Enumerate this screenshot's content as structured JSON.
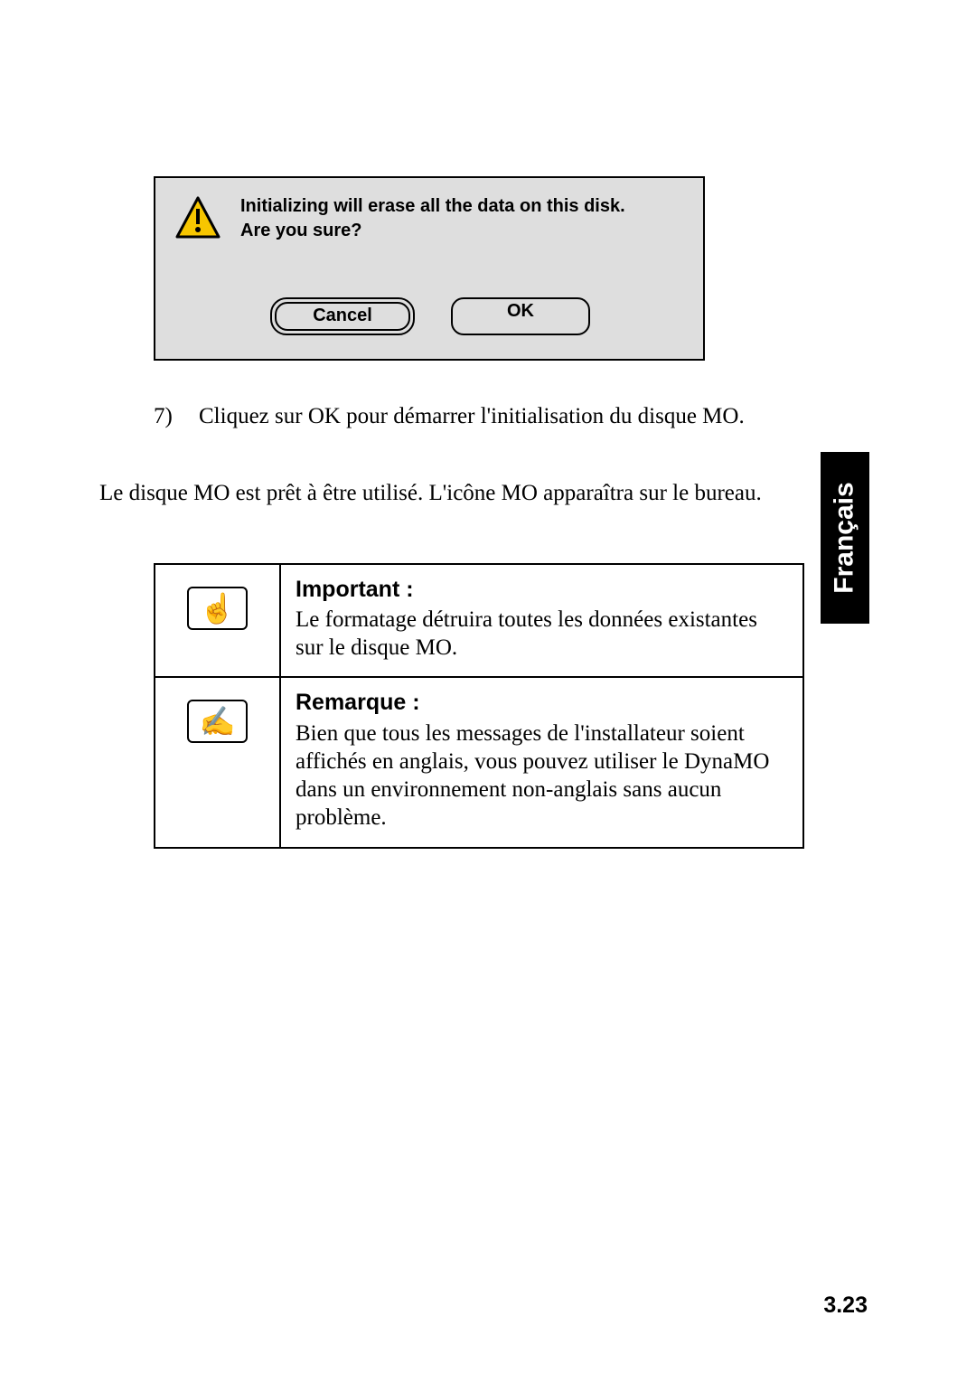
{
  "dialog": {
    "line1": "Initializing will erase all the data on this disk.",
    "line2": "Are you sure?",
    "cancel_label": "Cancel",
    "ok_label": "OK"
  },
  "step": {
    "number": "7)",
    "text": "Cliquez sur OK pour démarrer l'initialisation du disque MO."
  },
  "body_text": "Le disque MO est prêt à être utilisé. L'icône MO apparaîtra sur le bureau.",
  "callouts": {
    "important": {
      "title": "Important :",
      "text": "Le formatage détruira toutes les données existantes sur le disque MO."
    },
    "remark": {
      "title": "Remarque :",
      "text": "Bien que tous les messages de l'installateur soient affichés en anglais, vous pouvez utiliser le DynaMO dans un environnement non-anglais sans aucun problème."
    }
  },
  "side_tab": "Français",
  "page_number": "3.23"
}
